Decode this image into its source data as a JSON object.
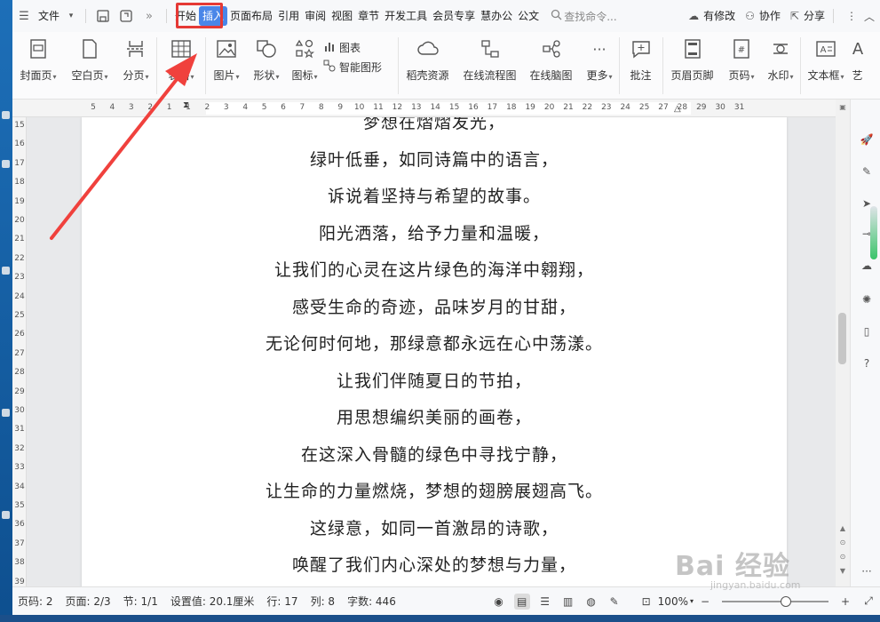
{
  "menubar": {
    "file": "文件",
    "tabs": [
      "开始",
      "插入",
      "页面布局",
      "引用",
      "审阅",
      "视图",
      "章节",
      "开发工具",
      "会员专享",
      "慧办公",
      "公文"
    ],
    "active_tab_index": 1,
    "search_placeholder": "查找命令...",
    "right": [
      "有修改",
      "协作",
      "分享"
    ]
  },
  "ribbon": {
    "cover": "封面页",
    "blank": "空白页",
    "pagebreak": "分页",
    "table": "表格",
    "picture": "图片",
    "shape": "形状",
    "icon": "图标",
    "chart": "图表",
    "smartart": "智能图形",
    "resource": "稻壳资源",
    "flowchart": "在线流程图",
    "mindmap": "在线脑图",
    "more": "更多",
    "comment": "批注",
    "headerfooter": "页眉页脚",
    "pagenum": "页码",
    "watermark": "水印",
    "textbox": "文本框",
    "art": "艺"
  },
  "ruler_h": [
    "5",
    "4",
    "3",
    "2",
    "1",
    "1",
    "2",
    "3",
    "4",
    "5",
    "6",
    "7",
    "8",
    "9",
    "10",
    "11",
    "12",
    "13",
    "14",
    "15",
    "16",
    "17",
    "18",
    "19",
    "20",
    "21",
    "22",
    "23",
    "24",
    "25",
    "27",
    "28",
    "29",
    "30",
    "31"
  ],
  "ruler_v": [
    "15",
    "16",
    "17",
    "18",
    "19",
    "20",
    "21",
    "22",
    "23",
    "24",
    "25",
    "26",
    "27",
    "28",
    "29",
    "30",
    "31",
    "32",
    "33",
    "34",
    "35",
    "36",
    "37",
    "38",
    "39"
  ],
  "poem": [
    "梦想在熠熠发光，",
    "绿叶低垂，如同诗篇中的语言，",
    "诉说着坚持与希望的故事。",
    "阳光洒落，给予力量和温暖，",
    "让我们的心灵在这片绿色的海洋中翱翔，",
    "感受生命的奇迹，品味岁月的甘甜，",
    "无论何时何地，那绿意都永远在心中荡漾。",
    "让我们伴随夏日的节拍，",
    "用思想编织美丽的画卷，",
    "在这深入骨髓的绿色中寻找宁静，",
    "让生命的力量燃烧，梦想的翅膀展翅高飞。",
    "这绿意，如同一首激昂的诗歌，",
    "唤醒了我们内心深处的梦想与力量，"
  ],
  "status": {
    "page_code": "页码: 2",
    "pages": "页面: 2/3",
    "section": "节: 1/1",
    "setting": "设置值: 20.1厘米",
    "row": "行: 17",
    "col": "列: 8",
    "words": "字数: 446",
    "zoom": "100%"
  },
  "watermark": {
    "main": "Bai 经验",
    "sub": "jingyan.baidu.com"
  },
  "colors": {
    "accent": "#4a86e8",
    "highlight": "#e53935",
    "arrow": "#f0413d"
  }
}
